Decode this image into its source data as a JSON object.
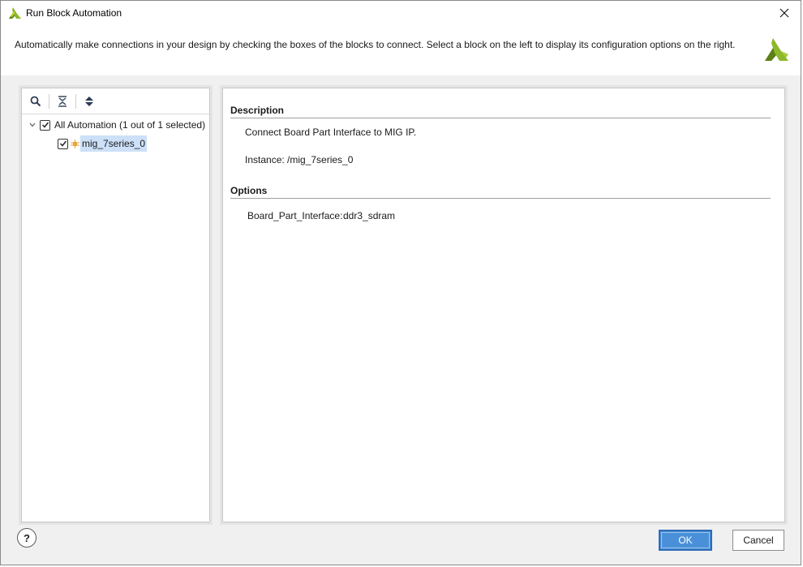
{
  "window": {
    "title": "Run Block Automation",
    "logo_icon": "xilinx-logo",
    "close_icon": "close-icon"
  },
  "header": {
    "text": "Automatically make connections in your design by checking the boxes of the blocks to connect. Select a block on the left to display its configuration options on the right.",
    "logo_icon": "xilinx-logo"
  },
  "tree": {
    "toolbar": [
      {
        "name": "search-icon"
      },
      {
        "name": "collapse-all-icon"
      },
      {
        "name": "expand-all-icon"
      }
    ],
    "root": {
      "label": "All Automation (1 out of 1 selected)",
      "checked": true,
      "expanded": true
    },
    "child": {
      "label": "mig_7series_0",
      "checked": true,
      "selected": true,
      "icon": "ip-block-icon"
    }
  },
  "details": {
    "description_header": "Description",
    "description_text": "Connect Board Part Interface to MIG IP.",
    "instance_text": "Instance: /mig_7series_0",
    "options_header": "Options",
    "option_label": "Board_Part_Interface:",
    "option_value": "ddr3_sdram"
  },
  "footer": {
    "help_label": "?",
    "ok_label": "OK",
    "cancel_label": "Cancel"
  },
  "colors": {
    "accent": "#4a90d9",
    "selection": "#cce0f7",
    "logo_green": "#8db82b",
    "logo_dark": "#5d7f16"
  }
}
